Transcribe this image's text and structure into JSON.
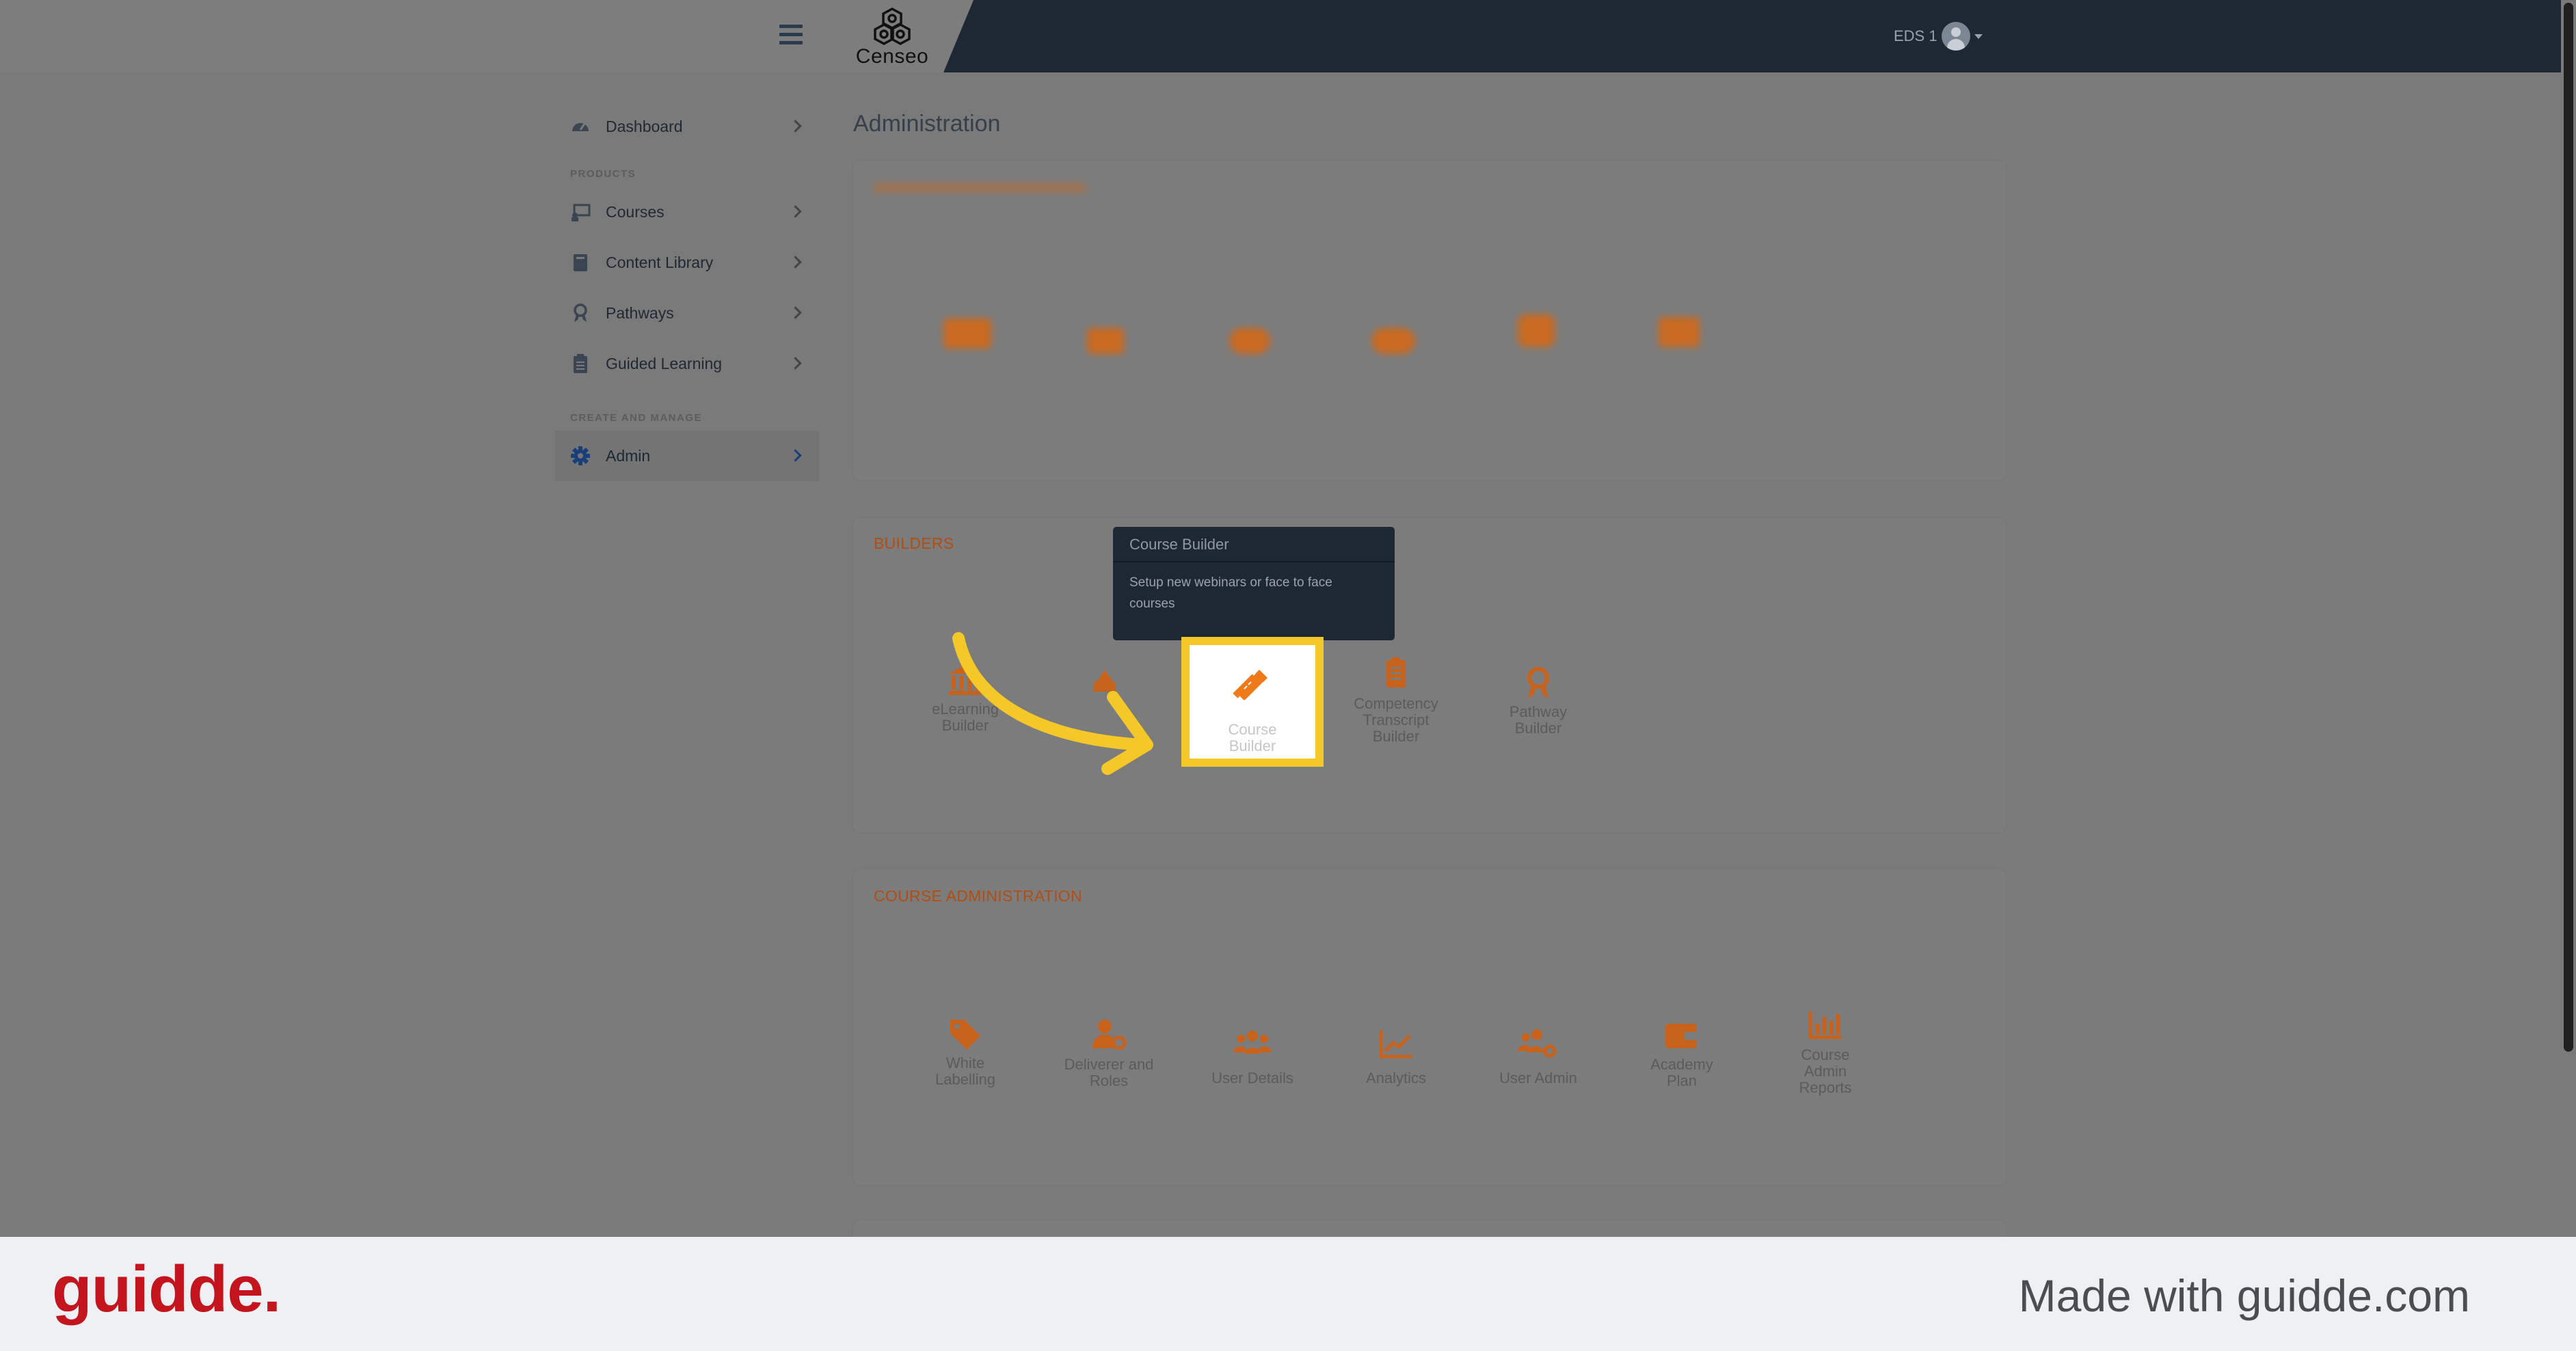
{
  "header": {
    "app_name": "Censeo",
    "user_name": "EDS 1"
  },
  "sidebar": {
    "dashboard": "Dashboard",
    "products_label": "PRODUCTS",
    "items": [
      {
        "label": "Courses",
        "icon": "courses-icon"
      },
      {
        "label": "Content Library",
        "icon": "book-icon"
      },
      {
        "label": "Pathways",
        "icon": "award-icon"
      },
      {
        "label": "Guided Learning",
        "icon": "clipboard-icon"
      }
    ],
    "create_manage_label": "CREATE AND MANAGE",
    "admin": "Admin"
  },
  "main": {
    "page_title": "Administration",
    "builders": {
      "title": "BUILDERS",
      "tiles": [
        {
          "label": "eLearning Builder",
          "icon": "bank-icon"
        },
        {
          "label": "Competency Transcript Builder",
          "icon": "clipboard-list-icon"
        },
        {
          "label": "Pathway Builder",
          "icon": "award-icon"
        }
      ],
      "highlighted": {
        "label": "Course Builder",
        "icon": "pencil-ruler-icon"
      }
    },
    "tooltip": {
      "title": "Course Builder",
      "text": "Setup new webinars or face to face courses"
    },
    "course_admin": {
      "title": "COURSE ADMINISTRATION",
      "tiles": [
        {
          "label": "White Labelling",
          "icon": "tags-icon"
        },
        {
          "label": "Deliverer and Roles",
          "icon": "user-cog-icon"
        },
        {
          "label": "User Details",
          "icon": "users-icon"
        },
        {
          "label": "Analytics",
          "icon": "chart-line-icon"
        },
        {
          "label": "User Admin",
          "icon": "users-cog-icon"
        },
        {
          "label": "Academy Plan",
          "icon": "wallet-icon"
        },
        {
          "label": "Course Admin Reports",
          "icon": "chart-bar-icon"
        }
      ]
    }
  },
  "footer": {
    "brand": "guidde.",
    "made_with": "Made with guidde.com"
  },
  "colors": {
    "accent_orange": "#e8731c",
    "highlight_yellow": "#f5c829",
    "navy": "#1e2835",
    "brand_red": "#c4141e"
  }
}
